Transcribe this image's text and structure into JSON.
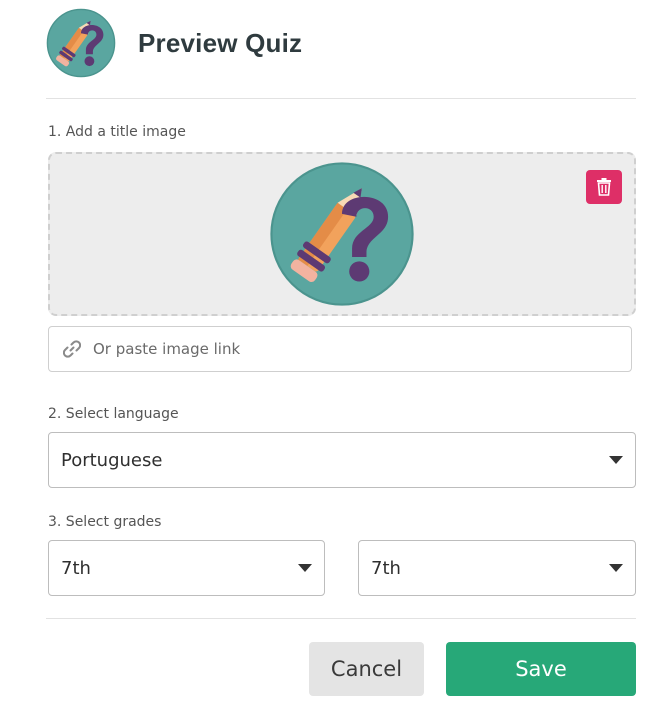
{
  "header": {
    "title": "Preview Quiz",
    "logo_icon": "quiz-pencil-question-icon"
  },
  "title_image": {
    "label": "1. Add a title image",
    "delete_icon": "trash-icon",
    "link_icon": "link-icon",
    "link_placeholder": "Or paste image link",
    "link_value": ""
  },
  "language": {
    "label": "2. Select language",
    "selected": "Portuguese"
  },
  "grades": {
    "label": "3. Select grades",
    "from": "7th",
    "to": "7th"
  },
  "actions": {
    "cancel_label": "Cancel",
    "save_label": "Save"
  },
  "colors": {
    "save_bg": "#27a878",
    "delete_bg": "#de2f67",
    "logo_circle": "#5aa6a0",
    "logo_question": "#5d3a73",
    "logo_pencil": "#f2a25c"
  }
}
